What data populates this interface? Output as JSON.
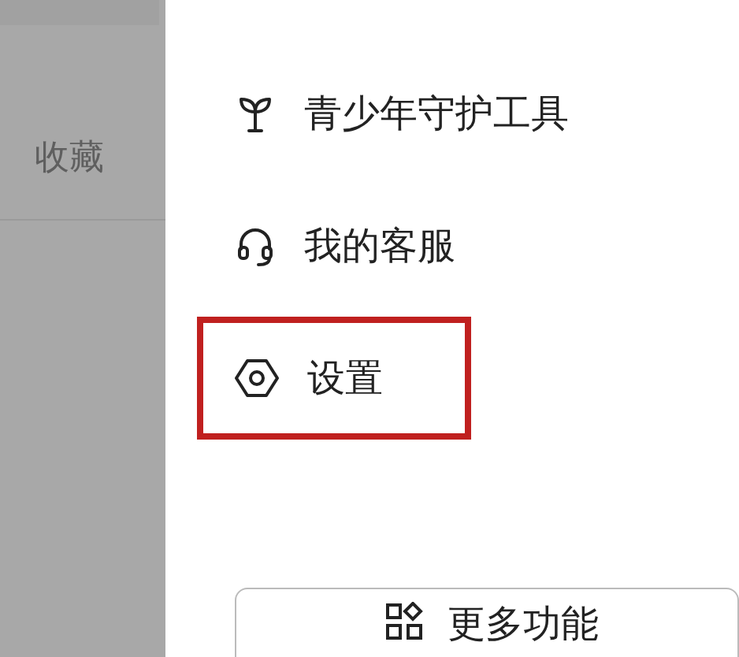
{
  "left_panel": {
    "tab": "收藏"
  },
  "menu": [
    {
      "kind": "sprout",
      "label": "青少年守护工具",
      "highlighted": false
    },
    {
      "kind": "headset",
      "label": "我的客服",
      "highlighted": false
    },
    {
      "kind": "settings",
      "label": "设置",
      "highlighted": true
    }
  ],
  "more_button": {
    "label": "更多功能"
  }
}
